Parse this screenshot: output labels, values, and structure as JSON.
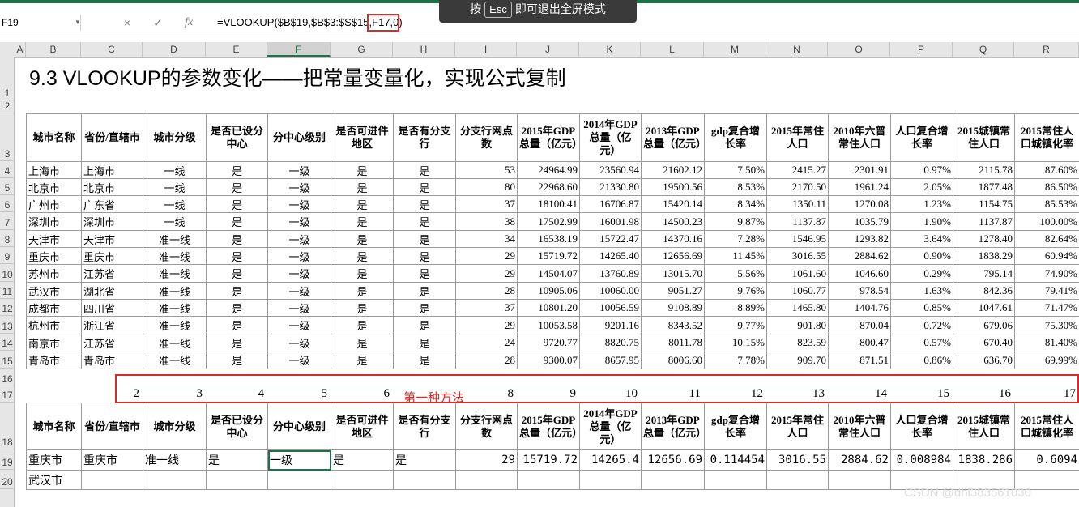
{
  "formula_bar": {
    "name_box": "F19",
    "cancel_icon": "×",
    "enter_icon": "✓",
    "fx_label": "fx",
    "formula": "=VLOOKUP($B$19,$B$3:$S$15,F17,0)"
  },
  "esc_banner": {
    "pre": "按",
    "key": "Esc",
    "post": "即可退出全屏模式"
  },
  "columns": [
    "A",
    "B",
    "C",
    "D",
    "E",
    "F",
    "G",
    "H",
    "I",
    "J",
    "K",
    "L",
    "M",
    "N",
    "O",
    "P",
    "Q",
    "R"
  ],
  "selected_column": "F",
  "rows": [
    "1",
    "2",
    "3",
    "4",
    "5",
    "6",
    "7",
    "8",
    "9",
    "10",
    "11",
    "12",
    "13",
    "14",
    "15",
    "16",
    "17",
    "18",
    "19",
    "20"
  ],
  "sheet_title": "9.3 VLOOKUP的参数变化——把常量变量化，实现公式复制",
  "headers": [
    "城市名称",
    "省份/直辖市",
    "城市分级",
    "是否已设分中心",
    "分中心级别",
    "是否可进件地区",
    "是否有分支行",
    "分支行网点数",
    "2015年GDP总量（亿元）",
    "2014年GDP总量（亿元）",
    "2013年GDP总量（亿元）",
    "gdp复合增长率",
    "2015年常住人口",
    "2010年六普常住人口",
    "人口复合增长率",
    "2015城镇常住人口",
    "2015常住人口城镇化率"
  ],
  "table_rows": [
    [
      "上海市",
      "上海市",
      "一线",
      "是",
      "一级",
      "是",
      "是",
      "53",
      "24964.99",
      "23560.94",
      "21602.12",
      "7.50%",
      "2415.27",
      "2301.91",
      "0.97%",
      "2115.78",
      "87.60%"
    ],
    [
      "北京市",
      "北京市",
      "一线",
      "是",
      "一级",
      "是",
      "是",
      "80",
      "22968.60",
      "21330.80",
      "19500.56",
      "8.53%",
      "2170.50",
      "1961.24",
      "2.05%",
      "1877.48",
      "86.50%"
    ],
    [
      "广州市",
      "广东省",
      "一线",
      "是",
      "一级",
      "是",
      "是",
      "37",
      "18100.41",
      "16706.87",
      "15420.14",
      "8.34%",
      "1350.11",
      "1270.08",
      "1.23%",
      "1154.75",
      "85.53%"
    ],
    [
      "深圳市",
      "深圳市",
      "一线",
      "是",
      "一级",
      "是",
      "是",
      "38",
      "17502.99",
      "16001.98",
      "14500.23",
      "9.87%",
      "1137.87",
      "1035.79",
      "1.90%",
      "1137.87",
      "100.00%"
    ],
    [
      "天津市",
      "天津市",
      "准一线",
      "是",
      "一级",
      "是",
      "是",
      "34",
      "16538.19",
      "15722.47",
      "14370.16",
      "7.28%",
      "1546.95",
      "1293.82",
      "3.64%",
      "1278.40",
      "82.64%"
    ],
    [
      "重庆市",
      "重庆市",
      "准一线",
      "是",
      "一级",
      "是",
      "是",
      "29",
      "15719.72",
      "14265.40",
      "12656.69",
      "11.45%",
      "3016.55",
      "2884.62",
      "0.90%",
      "1838.29",
      "60.94%"
    ],
    [
      "苏州市",
      "江苏省",
      "准一线",
      "是",
      "一级",
      "是",
      "是",
      "29",
      "14504.07",
      "13760.89",
      "13015.70",
      "5.56%",
      "1061.60",
      "1046.60",
      "0.29%",
      "795.14",
      "74.90%"
    ],
    [
      "武汉市",
      "湖北省",
      "准一线",
      "是",
      "一级",
      "是",
      "是",
      "28",
      "10905.06",
      "10060.00",
      "9051.27",
      "9.76%",
      "1060.77",
      "978.54",
      "1.63%",
      "842.36",
      "79.41%"
    ],
    [
      "成都市",
      "四川省",
      "准一线",
      "是",
      "一级",
      "是",
      "是",
      "37",
      "10801.20",
      "10056.59",
      "9108.89",
      "8.89%",
      "1465.80",
      "1404.76",
      "0.85%",
      "1047.61",
      "71.47%"
    ],
    [
      "杭州市",
      "浙江省",
      "准一线",
      "是",
      "一级",
      "是",
      "是",
      "29",
      "10053.58",
      "9201.16",
      "8343.52",
      "9.77%",
      "901.80",
      "870.04",
      "0.72%",
      "679.06",
      "75.30%"
    ],
    [
      "南京市",
      "江苏省",
      "准一线",
      "是",
      "一级",
      "是",
      "是",
      "24",
      "9720.77",
      "8820.75",
      "8011.78",
      "10.15%",
      "823.59",
      "800.47",
      "0.57%",
      "670.40",
      "81.40%"
    ],
    [
      "青岛市",
      "青岛市",
      "准一线",
      "是",
      "一级",
      "是",
      "是",
      "28",
      "9300.07",
      "8657.95",
      "8006.60",
      "7.78%",
      "909.70",
      "871.51",
      "0.86%",
      "636.70",
      "69.99%"
    ]
  ],
  "index_numbers": [
    "2",
    "3",
    "4",
    "5",
    "6",
    "8",
    "9",
    "10",
    "11",
    "12",
    "13",
    "14",
    "15",
    "16",
    "17"
  ],
  "method_label": "第一种方法",
  "lookup_rows": [
    [
      "重庆市",
      "重庆市",
      "准一线",
      "是",
      "一级",
      "是",
      "是",
      "29",
      "15719.72",
      "14265.4",
      "12656.69",
      "0.114454",
      "3016.55",
      "2884.62",
      "0.008984",
      "1838.286",
      "0.6094"
    ],
    [
      "武汉市",
      "",
      "",
      "",
      "",
      "",
      "",
      "",
      "",
      "",
      "",
      "",
      "",
      "",
      "",
      "",
      ""
    ]
  ],
  "watermark": "CSDN @dhl383561030"
}
